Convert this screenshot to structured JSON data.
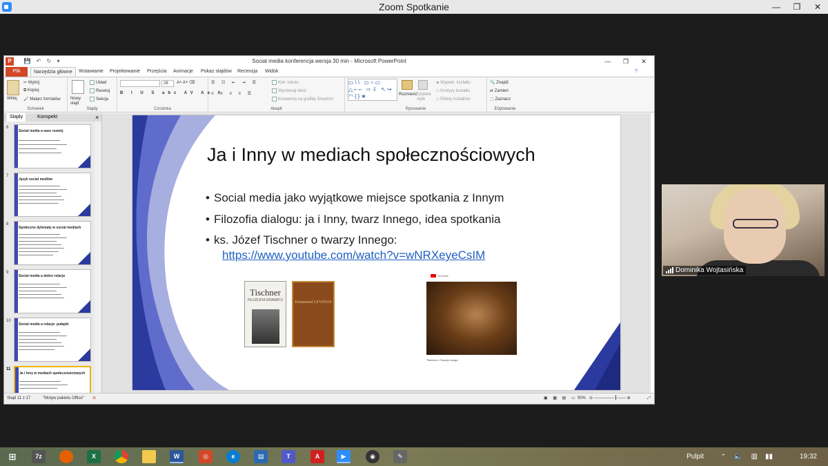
{
  "zoom": {
    "window_title": "Zoom Spotkanie",
    "minimize": "—",
    "maximize": "❐",
    "close": "✕",
    "participant_name": "Dominika Wojtasińska"
  },
  "ppt": {
    "window_title": "Social media konferencja wersja 30 min  -  Microsoft PowerPoint",
    "tabs": [
      "Plik",
      "Narzędzia główne",
      "Wstawianie",
      "Projektowanie",
      "Przejścia",
      "Animacje",
      "Pokaz slajdów",
      "Recenzja",
      "Widok"
    ],
    "ribbon": {
      "clipboard": {
        "cut": "Wytnij",
        "copy": "Kopiuj",
        "painter": "Malarz formatów",
        "paste": "Wklej",
        "label": "Schowek"
      },
      "slides": {
        "new": "Nowy slajd",
        "layout": "Układ",
        "reset": "Resetuj",
        "section": "Sekcja",
        "label": "Slajdy"
      },
      "font": {
        "label": "Czcionka",
        "size": "28"
      },
      "paragraph": {
        "direction": "Kier. tekstu",
        "align": "Wyrównaj tekst",
        "smartart": "Konwertuj na grafikę SmartArt",
        "label": "Akapit"
      },
      "drawing": {
        "arrange": "Rozmieść",
        "quick_styles": "Szybkie style",
        "fill": "Wypełn. kształtu",
        "outline": "Kontury kształtu",
        "effects": "Efekty kształtów",
        "label": "Rysowanie"
      },
      "editing": {
        "find": "Znajdź",
        "replace": "Zamień",
        "select": "Zaznacz",
        "label": "Edytowanie"
      }
    },
    "pane_tabs": [
      "Slajdy",
      "Konspekt"
    ],
    "pane_close": "×",
    "thumbnails": [
      {
        "num": "6",
        "title": "Social media a nasz rozwój"
      },
      {
        "num": "7",
        "title": "Język social mediów"
      },
      {
        "num": "8",
        "title": "Społeczne dylematy w social mediach"
      },
      {
        "num": "9",
        "title": "Social media a dobre relacje"
      },
      {
        "num": "10",
        "title": "Social media a relacje: pułapki"
      },
      {
        "num": "11",
        "title": "Ja i Inny w mediach społecznościowych"
      }
    ],
    "slide": {
      "title": "Ja i Inny w mediach społecznościowych",
      "bullets": [
        "Social media jako wyjątkowe miejsce spotkania z Innym",
        "Filozofia dialogu: ja i Inny, twarz Innego, idea spotkania",
        "ks. Józef Tischner o twarzy Innego:"
      ],
      "link": "https://www.youtube.com/watch?v=wNRXeyeCsIM",
      "book1_title": "Tischner",
      "book1_sub": "FILOZOFIA DRAMATU",
      "book2_title": "Emmanuel LEVINAS",
      "yt_brand": "YouTube",
      "yt_caption": "Tischner o Twarzy Innego"
    },
    "status": {
      "slide_of": "Slajd 11 z 17",
      "theme": "\"Motyw pakietu Office\"",
      "zoom": "90%"
    }
  },
  "taskbar": {
    "desktop": "Pulpit",
    "time": "19:32"
  },
  "colors": {
    "ppt_orange": "#d24726",
    "slide_blue": "#2b3a9e",
    "link_blue": "#1f5fc4",
    "zoom_blue": "#2d8cff"
  }
}
